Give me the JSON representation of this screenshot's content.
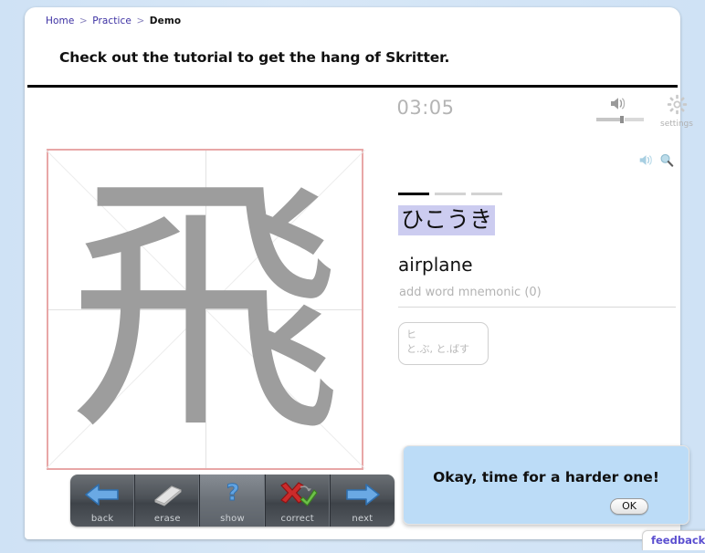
{
  "breadcrumb": {
    "items": [
      "Home",
      "Practice",
      "Demo"
    ],
    "separator": ">"
  },
  "headline": "Check out the tutorial to get the hang of Skritter.",
  "session": {
    "timer": "03:05"
  },
  "audio": {
    "speaker_icon": "speaker-icon",
    "volume_value": 50
  },
  "settings": {
    "label": "settings",
    "icon": "gear-icon"
  },
  "canvas": {
    "glyph": "飛",
    "border_color": "#e8a7a7",
    "stroke_color": "#9d9d9d"
  },
  "toolbar": {
    "buttons": [
      {
        "label": "back",
        "icon": "arrow-left-icon",
        "active": false
      },
      {
        "label": "erase",
        "icon": "eraser-icon",
        "active": false
      },
      {
        "label": "show",
        "icon": "question-mark-icon",
        "active": true
      },
      {
        "label": "correct",
        "icon": "mark-correct-icon",
        "active": false
      },
      {
        "label": "next",
        "icon": "arrow-right-icon",
        "active": false
      }
    ]
  },
  "vocab": {
    "audio_icon": "speaker-icon",
    "lookup_icon": "magnifier-icon",
    "prompt_dashes": [
      true,
      false,
      false
    ],
    "reading": "ひこうき",
    "reading_highlight": "#ccccf0",
    "definition": "airplane",
    "mnemonic_placeholder": "add word mnemonic (0)",
    "kanji_chip": {
      "onyomi": "ヒ",
      "kunyomi": "と.ぶ, と.ばす"
    }
  },
  "dialog": {
    "message": "Okay, time for a harder one!",
    "ok_label": "OK",
    "background": "#bcdcf7"
  },
  "feedback": {
    "label": "feedback"
  }
}
